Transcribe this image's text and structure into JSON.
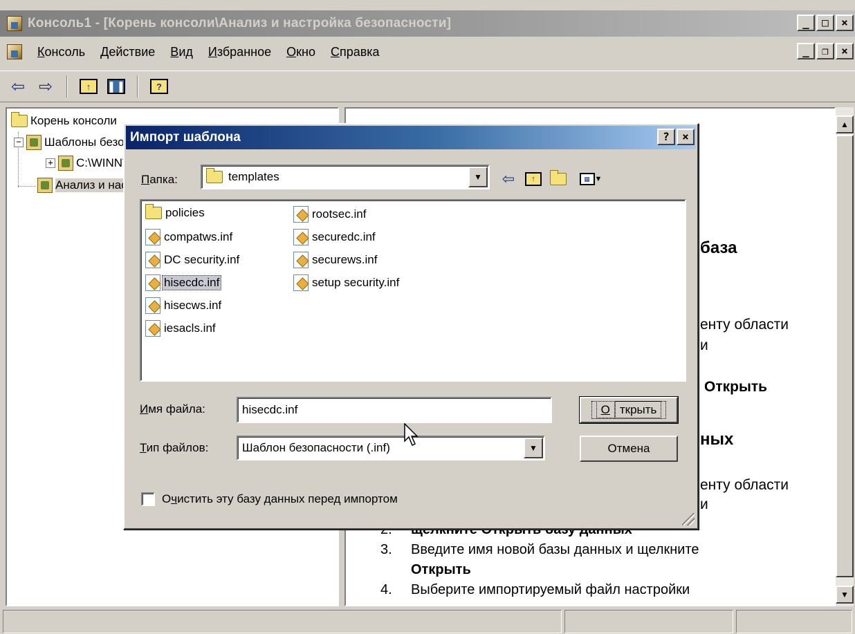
{
  "window": {
    "title": "Консоль1 - [Корень консоли\\Анализ и настройка безопасности]",
    "min": "_",
    "max": "□",
    "close": "×"
  },
  "menubar": {
    "items": [
      {
        "label_u": "К",
        "label_rest": "онсоль"
      },
      {
        "label_u": "Д",
        "label_rest": "ействие"
      },
      {
        "label_u": "В",
        "label_rest": "ид"
      },
      {
        "label_u": "И",
        "label_rest": "збранное"
      },
      {
        "label_u": "О",
        "label_rest": "кно"
      },
      {
        "label_u": "С",
        "label_rest": "правка"
      }
    ],
    "mdi_min": "_",
    "mdi_restore": "❐",
    "mdi_close": "×"
  },
  "toolbar": {
    "back": "⇦",
    "forward": "⇨",
    "up_icon": "up-folder-icon",
    "show_tree_icon": "show-tree-icon",
    "help_icon": "help-icon"
  },
  "tree": {
    "root": "Корень консоли",
    "item1": "Шаблоны безопасности",
    "item1_child": "C:\\WINNT\\security\\templates",
    "item2": "Анализ и настройка безопасности"
  },
  "result": {
    "heading1": "база",
    "line1": "енту области",
    "line1b": "и",
    "line2": "Открыть",
    "heading2": "ных",
    "line3": "енту области",
    "line3b": "и",
    "step2_num": "2.",
    "step2_text": "щелкните Открыть базу данных",
    "step3_num": "3.",
    "step3_text": "Введите имя новой базы данных и щелкните",
    "step3_text2": "Открыть",
    "step4_num": "4.",
    "step4_text": "Выберите импортируемый файл настройки"
  },
  "dialog": {
    "title": "Импорт шаблона",
    "help": "?",
    "close": "×",
    "folder_label_u": "П",
    "folder_label_rest": "апка:",
    "folder_value": "templates",
    "files_col1": [
      "policies",
      "compatws.inf",
      "DC security.inf",
      "hisecdc.inf",
      "hisecws.inf",
      "iesacls.inf"
    ],
    "files_col2": [
      "rootsec.inf",
      "securedc.inf",
      "securews.inf",
      "setup security.inf"
    ],
    "selected_file": "hisecdc.inf",
    "filename_label_u": "И",
    "filename_label_rest": "мя файла:",
    "filename_value": "hisecdc.inf",
    "filetype_label_u": "Т",
    "filetype_label_rest": "ип файлов:",
    "filetype_value": "Шаблон безопасности (.inf)",
    "open_button_u": "О",
    "open_button_rest": "ткрыть",
    "cancel_button": "Отмена",
    "checkbox_label_pre": "О",
    "checkbox_label_u": "ч",
    "checkbox_label_rest": "истить эту базу данных перед импортом",
    "checkbox_checked": false
  },
  "colors": {
    "face": "#d4d0c8",
    "active_title": "#0a246a",
    "inactive_title": "#808080"
  }
}
